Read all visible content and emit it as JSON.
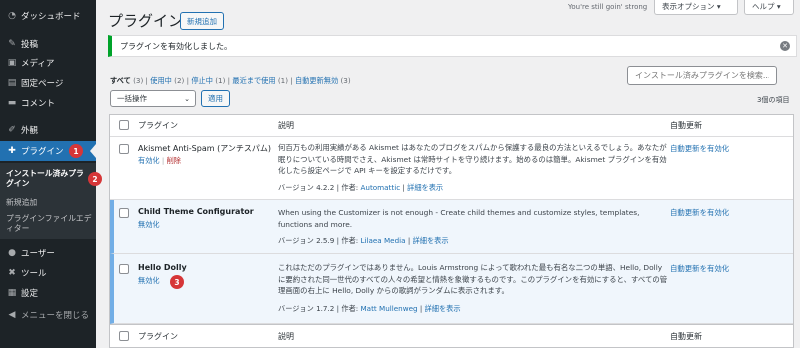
{
  "sidebar": {
    "items": [
      {
        "label": "ダッシュボード",
        "icon": "dashboard-icon"
      },
      {
        "label": "投稿",
        "icon": "pin-icon"
      },
      {
        "label": "メディア",
        "icon": "media-icon"
      },
      {
        "label": "固定ページ",
        "icon": "page-icon"
      },
      {
        "label": "コメント",
        "icon": "comment-icon"
      },
      {
        "label": "外観",
        "icon": "brush-icon"
      },
      {
        "label": "プラグイン",
        "icon": "plugin-icon",
        "badge": "1"
      },
      {
        "label": "ユーザー",
        "icon": "user-icon"
      },
      {
        "label": "ツール",
        "icon": "wrench-icon"
      },
      {
        "label": "設定",
        "icon": "settings-icon"
      },
      {
        "label": "メニューを閉じる",
        "icon": "collapse-icon"
      }
    ],
    "submenu": [
      {
        "label": "インストール済みプラグイン"
      },
      {
        "label": "新規追加"
      },
      {
        "label": "プラグインファイルエディター"
      }
    ],
    "submenu_badge": "2"
  },
  "header": {
    "title": "プラグイン",
    "add_new": "新規追加",
    "greeting": "You're still goin' strong",
    "screen_options": "表示オプション ▾",
    "help": "ヘルプ ▾"
  },
  "notice": {
    "text": "プラグインを有効化しました。"
  },
  "filters": {
    "all": "すべて",
    "all_count": "(3)",
    "active": "使用中",
    "active_count": "(2)",
    "inactive": "停止中",
    "inactive_count": "(1)",
    "recent": "最近まで使用",
    "recent_count": "(1)",
    "auto_disabled": "自動更新無効",
    "auto_disabled_count": "(3)"
  },
  "search": {
    "placeholder": "インストール済みプラグインを検索..."
  },
  "bulk": {
    "selected": "一括操作",
    "apply": "適用",
    "count": "3個の項目"
  },
  "table": {
    "col_plugin": "プラグイン",
    "col_desc": "説明",
    "col_auto": "自動更新",
    "rows": [
      {
        "name": "Akismet Anti-Spam (アンチスパム)",
        "action1": "有効化",
        "action2": "削除",
        "desc": "何百万もの利用実績がある Akismet はあなたのブログをスパムから保護する最良の方法といえるでしょう。あなたが眠りについている時間でさえ、Akismet は常時サイトを守り続けます。始めるのは簡単。Akismet プラグインを有効化したら設定ページで API キーを設定するだけです。",
        "version": "バージョン 4.2.2",
        "author_label": "作者:",
        "author": "Automattic",
        "details": "詳細を表示",
        "auto": "自動更新を有効化"
      },
      {
        "name": "Child Theme Configurator",
        "action1": "無効化",
        "desc": "When using the Customizer is not enough - Create child themes and customize styles, templates, functions and more.",
        "version": "バージョン 2.5.9",
        "author_label": "作者:",
        "author": "Lilaea Media",
        "details": "詳細を表示",
        "auto": "自動更新を有効化"
      },
      {
        "name": "Hello Dolly",
        "action1": "無効化",
        "badge": "3",
        "desc": "これはただのプラグインではありません。Louis Armstrong によって歌われた最も有名な二つの単語、Hello, Dolly に要約された同一世代のすべての人々の希望と情熱を象徴するものです。このプラグインを有効にすると、すべての管理画面の右上に Hello, Dolly からの歌詞がランダムに表示されます。",
        "version": "バージョン 1.7.2",
        "author_label": "作者:",
        "author": "Matt Mullenweg",
        "details": "詳細を表示",
        "auto": "自動更新を有効化"
      }
    ]
  },
  "colors": {
    "sidebar": "#1d2327",
    "accent": "#2271b1",
    "badge": "#d63638",
    "notice": "#00a32a"
  }
}
